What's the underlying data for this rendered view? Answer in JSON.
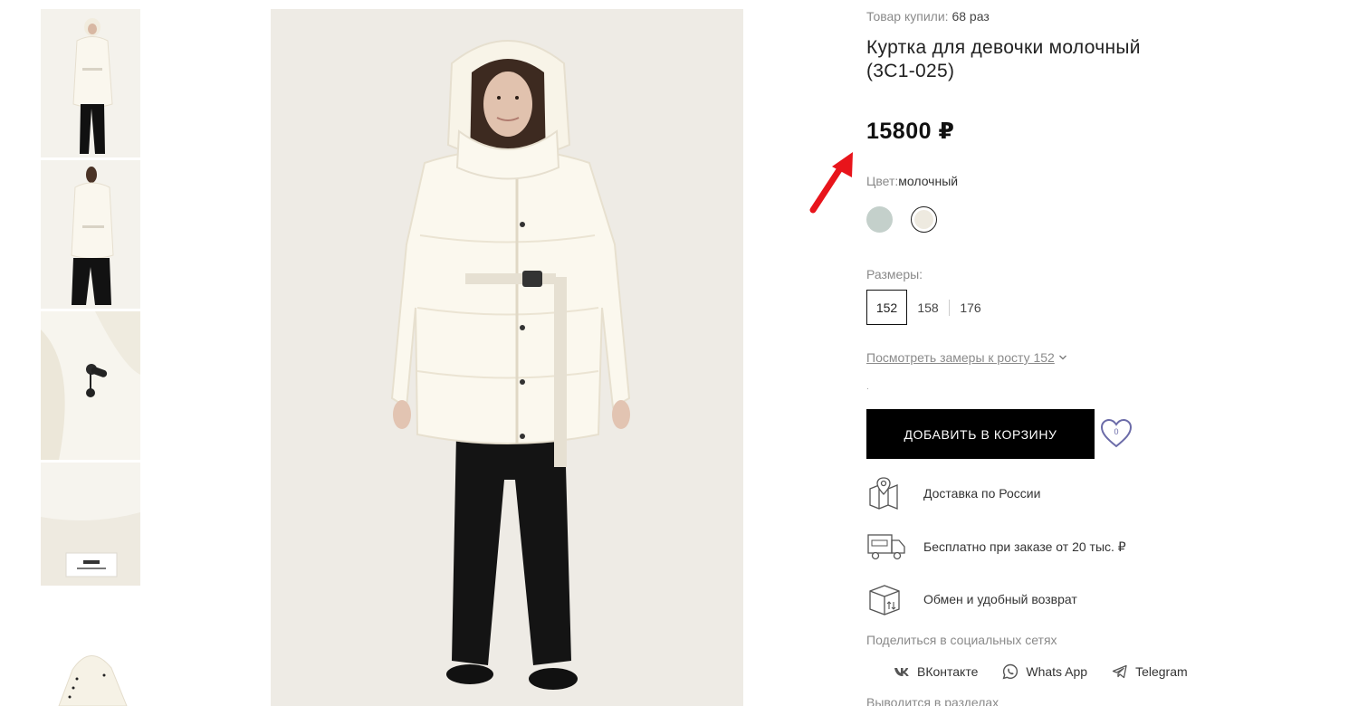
{
  "gallery": {
    "thumbnails": [
      {
        "alt": "front-view"
      },
      {
        "alt": "back-view"
      },
      {
        "alt": "button-detail"
      },
      {
        "alt": "label-detail"
      },
      {
        "alt": "folded-view"
      }
    ],
    "main_image": {
      "alt": "girl-in-milky-jacket"
    }
  },
  "product": {
    "bought_prefix": "Товар купили:",
    "bought_value": "68 раз",
    "title": "Куртка для девочки молочный (3С1-025)",
    "price": "15800 ₽",
    "color_label": "Цвет:",
    "color_value": "молочный",
    "colors": [
      {
        "name": "sage",
        "hex": "#c4d0cb",
        "selected": false
      },
      {
        "name": "milky",
        "hex": "#eeeae0",
        "selected": true
      }
    ],
    "sizes_label": "Размеры:",
    "sizes": [
      "152",
      "158",
      "176"
    ],
    "selected_size": "152",
    "measure_link": "Посмотреть замеры к росту 152",
    "dot": ".",
    "add_to_cart": "ДОБАВИТЬ В КОРЗИНУ",
    "wishlist_count": "0"
  },
  "features": [
    {
      "icon": "map-pin-icon",
      "text": "Доставка по России"
    },
    {
      "icon": "free-delivery-truck-icon",
      "text": "Бесплатно при заказе от 20 тыс. ₽"
    },
    {
      "icon": "box-exchange-icon",
      "text": "Обмен и удобный возврат"
    }
  ],
  "share": {
    "label": "Поделиться в социальных сетях",
    "items": [
      {
        "icon": "vk-icon",
        "label": "ВКонтакте"
      },
      {
        "icon": "whatsapp-icon",
        "label": "Whats App"
      },
      {
        "icon": "telegram-icon",
        "label": "Telegram"
      }
    ]
  },
  "sections_label": "Выводится в разделах",
  "colors": {
    "accent_arrow": "#e8141b",
    "button_bg": "#000000",
    "wishlist": "#6b6ba8"
  }
}
